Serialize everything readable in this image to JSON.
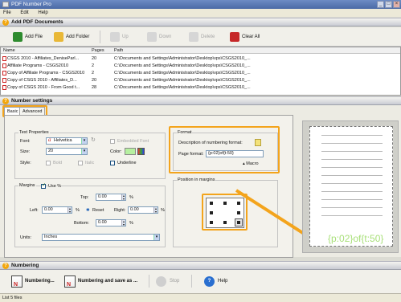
{
  "window": {
    "title": "PDF Number Pro",
    "minimize": "_",
    "maximize": "□",
    "close": "×"
  },
  "menu": [
    "File",
    "Edit",
    "Help"
  ],
  "add_section": {
    "title": "Add PDF Documents"
  },
  "toolbar": {
    "add_file": "Add File",
    "add_folder": "Add Folder",
    "up": "Up",
    "down": "Down",
    "delete": "Delete",
    "clear_all": "Clear All"
  },
  "file_list": {
    "columns": [
      "Name",
      "Pages",
      "Path"
    ],
    "rows": [
      {
        "name": "CSGS 2010 - Affiliates_DeniseParl...",
        "pages": "20",
        "path": "C:\\Documents and Settings\\Administrator\\Desktop\\vps\\CSGS2010_..."
      },
      {
        "name": "Affiliate Programs - CSGS2010",
        "pages": "2",
        "path": "C:\\Documents and Settings\\Administrator\\Desktop\\vps\\CSGS2010_..."
      },
      {
        "name": "Copy of Affiliate Programs - CSGS2010",
        "pages": "2",
        "path": "C:\\Documents and Settings\\Administrator\\Desktop\\vps\\CSGS2010_..."
      },
      {
        "name": "Copy of CSGS 2010 - Affiliates_D...",
        "pages": "20",
        "path": "C:\\Documents and Settings\\Administrator\\Desktop\\vps\\CSGS2010_..."
      },
      {
        "name": "Copy of CSGS 2010 - From Good t...",
        "pages": "28",
        "path": "C:\\Documents and Settings\\Administrator\\Desktop\\vps\\CSGS2010_..."
      }
    ]
  },
  "number_section": {
    "title": "Number settings"
  },
  "tabs": {
    "basic": "Basic",
    "advanced": "Advanced"
  },
  "text_properties": {
    "group": "Text Properties",
    "font_label": "Font:",
    "font_value": "Helvetica",
    "font_glyph": "a",
    "embedded_font": "Embedded Font",
    "size_label": "Size:",
    "size_value": "20",
    "color_label": "Color:",
    "style_label": "Style:",
    "bold": "Bold",
    "italic": "Italic",
    "underline": "Underline"
  },
  "margins": {
    "group": "Margins",
    "use_percent": "Use %",
    "top_label": "Top:",
    "top_value": "0.00",
    "pct": "%",
    "left_label": "Left:",
    "left_value": "0.00",
    "reset": "Reset",
    "right_label": "Right:",
    "right_value": "0.00",
    "bottom_label": "Bottom:",
    "bottom_value": "0.00",
    "units_label": "Units:",
    "units_value": "Inches"
  },
  "format": {
    "group": "Format",
    "description_label": "Description of numbering format:",
    "page_format_label": "Page format:",
    "page_format_value": "{p:02}of{t:50}",
    "macro": "Macro"
  },
  "position": {
    "group": "Position in margins"
  },
  "preview": {
    "stamp": "{p:02}of{t:50}"
  },
  "numbering_section": {
    "title": "Numbering"
  },
  "actions": {
    "numbering": "Numbering...",
    "numbering_save": "Numbering and save as ...",
    "stop": "Stop",
    "help": "Help"
  },
  "status": {
    "text": "List 5 files"
  },
  "colors": {
    "accent_orange": "#f3a41c",
    "stamp_green": "#a9e07a",
    "swatch": "#b6f0a0"
  }
}
